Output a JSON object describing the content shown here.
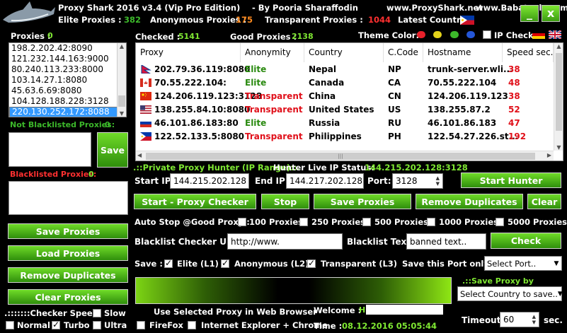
{
  "title": {
    "app": "Proxy Shark 2016 v3.4 (Vip Pro Edition)",
    "by": "-  By Pooria Sharaffodin",
    "site1": "www.ProxyShark.net",
    "site2": "www.Babatools.com",
    "minimize": "_",
    "close": "x"
  },
  "stats": {
    "elite_label": "Elite Proxies :",
    "elite_value": "382",
    "anon_label": "Anonymous  Proxies :",
    "anon_value": "175",
    "trans_label": "Transparent Proxies :",
    "trans_value": "1044",
    "country_label": "Latest Country:"
  },
  "left": {
    "proxies_label": "Proxies :",
    "proxies_count": "0",
    "proxies": [
      "198.2.202.42:8090",
      "121.232.144.163:9000",
      "80.240.113.233:8000",
      "103.14.27.1:8080",
      "45.63.6.69:8080",
      "104.128.188.228:3128",
      "220.130.252.172:8088"
    ],
    "selected_index": 6,
    "not_blacklisted_label": "Not Blacklisted Proxies:",
    "not_blacklisted_count": "0",
    "save_label": "Save",
    "blacklisted_label": "Blacklisted Proxies:",
    "blacklisted_count": "0",
    "save_proxies": "Save Proxies",
    "load_proxies": "Load Proxies",
    "remove_duplicates": "Remove Duplicates",
    "clear_proxies": "Clear Proxies",
    "checker_speed_label": ".:::::::Checker Speed:",
    "speeds": [
      {
        "label": "Slow",
        "checked": false
      },
      {
        "label": "Normal",
        "checked": false
      },
      {
        "label": "Turbo",
        "checked": true
      },
      {
        "label": "Ultra",
        "checked": false
      }
    ]
  },
  "top": {
    "checked_label": "Checked :",
    "checked_value": "5141",
    "good_label": "Good Proxies :",
    "good_value": "2138",
    "theme_label": "Theme Color:",
    "theme_colors": [
      "#e8202a",
      "#e4d21a",
      "#3cb82a",
      "#2456d8"
    ],
    "ip_check_label": "IP Check"
  },
  "table": {
    "headers": [
      "Proxy",
      "Anonymity",
      "Country",
      "C.Code",
      "Hostname",
      "Speed sec."
    ],
    "rows": [
      {
        "proxy": "202.79.36.119:8080",
        "anonymity": "Elite",
        "country": "Nepal",
        "code": "NP",
        "host": "trunk-server.wli...",
        "speed": "38",
        "flag": "np"
      },
      {
        "proxy": "70.55.222.104:",
        "anonymity": "Elite",
        "country": "Canada",
        "code": "CA",
        "host": "70.55.222.104",
        "speed": "48",
        "flag": "ca"
      },
      {
        "proxy": "124.206.119.123:3128",
        "anonymity": "Transparent",
        "country": "China",
        "code": "CN",
        "host": "124.206.119.123",
        "speed": "38",
        "flag": "cn"
      },
      {
        "proxy": "138.255.84.10:8080",
        "anonymity": "Transparent",
        "country": "United States",
        "code": "US",
        "host": "138.255.87.2",
        "speed": "52",
        "flag": "us"
      },
      {
        "proxy": "46.101.86.183:80",
        "anonymity": "Elite",
        "country": "Russia",
        "code": "RU",
        "host": "46.101.86.183",
        "speed": "47",
        "flag": "ru"
      },
      {
        "proxy": "122.52.133.5:8080",
        "anonymity": "Transparent",
        "country": "Philippines",
        "code": "PH",
        "host": "122.54.27.226.st...",
        "speed": "192",
        "flag": "ph"
      }
    ]
  },
  "hunter": {
    "title": ".::Private Proxy Hunter (IP Range)::.",
    "live_label": "Hunter Live IP Status:",
    "live_value": "144.215.202.128:3128",
    "start_ip_label": "Start IP:",
    "start_ip": "144.215.202.128",
    "end_ip_label": "End IP:",
    "end_ip": "144.217.202.128",
    "port_label": "Port:",
    "port": "3128",
    "start_hunter": "Start Hunter"
  },
  "actions": {
    "start_checker": "Start - Proxy Checker",
    "stop": "Stop",
    "save_proxies": "Save Proxies",
    "remove_duplicates": "Remove Duplicates",
    "clear": "Clear"
  },
  "autostop": {
    "label": "Auto Stop @Good Proxy :",
    "options": [
      "100 Proxies",
      "250 Proxies",
      "500 Proxies",
      "1000 Proxies",
      "5000 Proxies"
    ]
  },
  "blacklist": {
    "url_label": "Blacklist Checker URL:",
    "url_value": "http://www.",
    "text_label": "Blacklist Text:",
    "text_value": "banned text..",
    "check": "Check"
  },
  "save": {
    "label": "Save :",
    "options": [
      {
        "label": "Elite (L1)",
        "checked": true
      },
      {
        "label": "Anonymous (L2)",
        "checked": true
      },
      {
        "label": "Transparent (L3)",
        "checked": true
      }
    ],
    "port_only_label": "Save this Port only :",
    "port_select": "Select Port..",
    "by_country_label": ".::Save Proxy by Country::.",
    "country_select": "Select Country to save.."
  },
  "bottom": {
    "browser_label": "Use Selected Proxy in Web Browser",
    "firefox": "FireFox",
    "ie_chrome": "Internet Explorer + Chrome",
    "welcome_label": "Welcome :",
    "welcome_value": "H",
    "time_label": "Time :",
    "time_value": "08.12.2016 05:05:44",
    "timeout_label": "Timeout :",
    "timeout_value": "60",
    "timeout_unit": "sec."
  }
}
